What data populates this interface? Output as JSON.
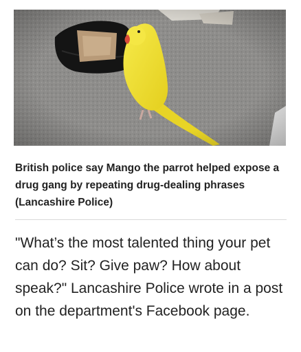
{
  "image": {
    "subject": "yellow-parrot",
    "background_color": "#8d8c8a"
  },
  "caption": {
    "text": "British police say Mango the parrot helped expose a drug gang by repeating drug-dealing phrases (Lancashire Police)"
  },
  "article": {
    "paragraph": "\"What’s the most talented thing your pet can do? Sit? Give paw? How about speak?\" Lancashire Police wrote in a post on the department's Facebook page."
  },
  "colors": {
    "parrot": "#f2e33a",
    "text": "#222222",
    "divider": "#d8d8d8"
  }
}
